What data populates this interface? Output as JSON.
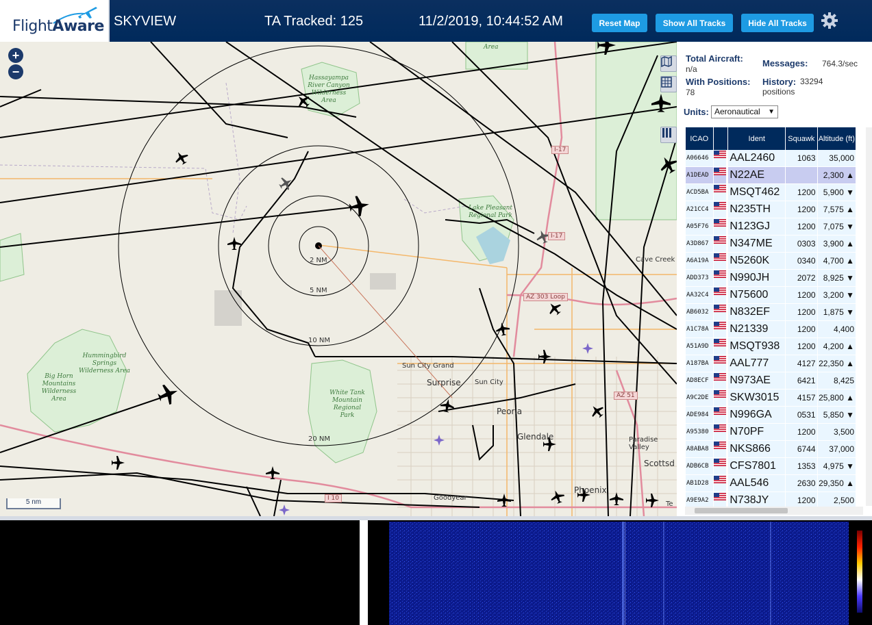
{
  "header": {
    "logo": "FlightAware",
    "title": "SKYVIEW",
    "tracked": "TA Tracked: 125",
    "datetime": "11/2/2019, 10:44:52 AM",
    "buttons": {
      "reset": "Reset Map",
      "show_all": "Show All Tracks",
      "hide_all": "Hide All Tracks"
    }
  },
  "map": {
    "zoom_in": "+",
    "zoom_out": "−",
    "scale": "5 nm",
    "ring_labels": [
      "2 NM",
      "5 NM",
      "10 NM",
      "20 NM"
    ],
    "places": {
      "area_top": "Area",
      "hassayampa": "Hassayampa River Canyon Wilderness Area",
      "lake_pleasant": "Lake Pleasant Regional Park",
      "cave_creek": "Cave Creek",
      "hummingbird": "Hummingbird Springs Wilderness Area",
      "big_horn": "Big Horn Mountains Wilderness Area",
      "white_tank": "White Tank Mountain Regional Park",
      "sun_city_grand": "Sun City Grand",
      "surprise": "Surprise",
      "sun_city": "Sun City",
      "peoria": "Peoria",
      "glendale": "Glendale",
      "paradise_valley": "Paradise Valley",
      "scottsdale": "Scottsd",
      "phoenix": "Phoenix",
      "goodyear": "Goodyear",
      "tempe": "Te"
    },
    "roads": {
      "i17_a": "I-17",
      "i17_b": "I-17",
      "az303": "AZ 303 Loop",
      "i10": "I 10",
      "az51": "AZ 51"
    }
  },
  "stats": {
    "total_aircraft_label": "Total Aircraft:",
    "total_aircraft_value": "n/a",
    "with_positions_label": "With Positions:",
    "with_positions_value": "78",
    "messages_label": "Messages:",
    "messages_value": "764.3/sec",
    "history_label": "History:",
    "history_value": "33294 positions",
    "units_label": "Units:",
    "units_value": "Aeronautical"
  },
  "table": {
    "headers": [
      "ICAO",
      "",
      "Ident",
      "Squawk",
      "Altitude (ft)"
    ],
    "rows": [
      {
        "icao": "A06646",
        "ident": "AAL2460",
        "squawk": "1063",
        "alt": "35,000"
      },
      {
        "icao": "A1DEAD",
        "ident": "N22AE",
        "squawk": "",
        "alt": "2,300 ▲"
      },
      {
        "icao": "ACD5BA",
        "ident": "MSQT462",
        "squawk": "1200",
        "alt": "5,900 ▼"
      },
      {
        "icao": "A21CC4",
        "ident": "N235TH",
        "squawk": "1200",
        "alt": "7,575 ▲"
      },
      {
        "icao": "A05F76",
        "ident": "N123GJ",
        "squawk": "1200",
        "alt": "7,075 ▼"
      },
      {
        "icao": "A3D867",
        "ident": "N347ME",
        "squawk": "0303",
        "alt": "3,900 ▲"
      },
      {
        "icao": "A6A19A",
        "ident": "N5260K",
        "squawk": "0340",
        "alt": "4,700 ▲"
      },
      {
        "icao": "ADD373",
        "ident": "N990JH",
        "squawk": "2072",
        "alt": "8,925 ▼"
      },
      {
        "icao": "AA32C4",
        "ident": "N75600",
        "squawk": "1200",
        "alt": "3,200 ▼"
      },
      {
        "icao": "AB6032",
        "ident": "N832EF",
        "squawk": "1200",
        "alt": "1,875 ▼"
      },
      {
        "icao": "A1C78A",
        "ident": "N21339",
        "squawk": "1200",
        "alt": "4,400"
      },
      {
        "icao": "A51A9D",
        "ident": "MSQT938",
        "squawk": "1200",
        "alt": "4,200 ▲"
      },
      {
        "icao": "A187BA",
        "ident": "AAL777",
        "squawk": "4127",
        "alt": "22,350 ▲"
      },
      {
        "icao": "AD8ECF",
        "ident": "N973AE",
        "squawk": "6421",
        "alt": "8,425"
      },
      {
        "icao": "A9C2DE",
        "ident": "SKW3015",
        "squawk": "4157",
        "alt": "25,800 ▲"
      },
      {
        "icao": "ADE984",
        "ident": "N996GA",
        "squawk": "0531",
        "alt": "5,850 ▼"
      },
      {
        "icao": "A95380",
        "ident": "N70PF",
        "squawk": "1200",
        "alt": "3,500"
      },
      {
        "icao": "A8ABA8",
        "ident": "NKS866",
        "squawk": "6744",
        "alt": "37,000"
      },
      {
        "icao": "ADB6CB",
        "ident": "CFS7801",
        "squawk": "1353",
        "alt": "4,975 ▼"
      },
      {
        "icao": "AB1D28",
        "ident": "AAL546",
        "squawk": "2630",
        "alt": "29,350 ▲"
      },
      {
        "icao": "A9E9A2",
        "ident": "N738JY",
        "squawk": "1200",
        "alt": "2,500"
      }
    ],
    "selected_row": 1
  },
  "colors": {
    "header_bg": "#002a5c",
    "button": "#1e9be3",
    "map_bg": "#efede4",
    "row_bg": "#eaf6ff",
    "selected_row": "#c8ccf0",
    "waterfall": "#0b1a8c"
  }
}
